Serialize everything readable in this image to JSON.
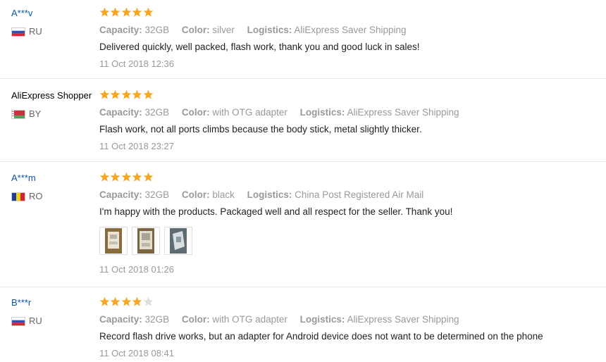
{
  "labels": {
    "capacity": "Capacity:",
    "color": "Color:",
    "logistics": "Logistics:"
  },
  "colors": {
    "star_filled": "#f6a623",
    "star_empty": "#dddddd",
    "user_link": "#0a55a8",
    "meta_text": "#999999"
  },
  "reviews": [
    {
      "user": "A***v",
      "country": "RU",
      "flag": "ru",
      "stars": 5,
      "capacity": "32GB",
      "color": "silver",
      "logistics": "AliExpress Saver Shipping",
      "text": "Delivered quickly, well packed, flash work, thank you and good luck in sales!",
      "date": "11 Oct 2018 12:36"
    },
    {
      "user": "AliExpress Shopper",
      "country": "BY",
      "flag": "by",
      "stars": 5,
      "capacity": "32GB",
      "color": "with OTG adapter",
      "logistics": "AliExpress Saver Shipping",
      "text": "Flash work, not all ports climbs because the body stick, metal slightly thicker.",
      "date": "11 Oct 2018 23:27"
    },
    {
      "user": "A***m",
      "country": "RO",
      "flag": "ro",
      "stars": 5,
      "capacity": "32GB",
      "color": "black",
      "logistics": "China Post Registered Air Mail",
      "text": "I'm happy with the products. Packaged well and all respect for the seller. Thank you!",
      "date": "11 Oct 2018 01:26",
      "photos": [
        "review-photo-1",
        "review-photo-2",
        "review-photo-3"
      ]
    },
    {
      "user": "B***r",
      "country": "RU",
      "flag": "ru",
      "stars": 4,
      "capacity": "32GB",
      "color": "with OTG adapter",
      "logistics": "AliExpress Saver Shipping",
      "text": "Record flash drive works, but an adapter for Android device does not want to be determined on the phone",
      "date": "11 Oct 2018 08:41"
    }
  ]
}
